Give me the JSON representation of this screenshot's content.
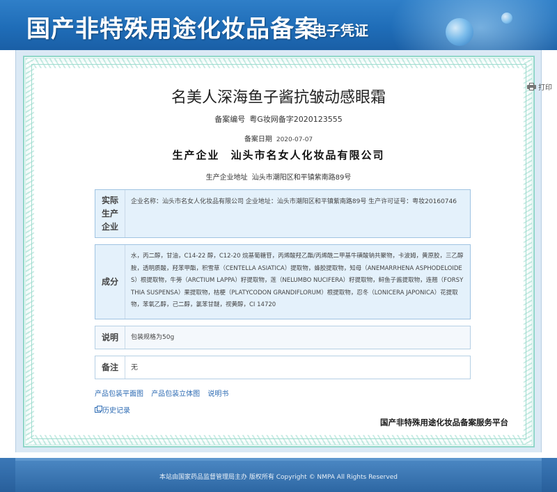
{
  "header": {
    "title": "国产非特殊用途化妆品备案",
    "subtitle": "电子凭证"
  },
  "toolbar": {
    "print_label": "打印"
  },
  "product": {
    "name": "名美人深海鱼子酱抗皱动感眼霜",
    "reg_no_label": "备案编号",
    "reg_no": "粤G妆网备字2020123555",
    "reg_date_label": "备案日期",
    "reg_date": "2020-07-07",
    "company_label": "生产企业",
    "company": "汕头市名女人化妆品有限公司",
    "address_label": "生产企业地址",
    "address": "汕头市潮阳区和平镇紫南路89号"
  },
  "sections": {
    "actual": {
      "label_1": "实际",
      "label_2": "生产",
      "label_3": "企业",
      "content": "企业名称：汕头市名女人化妆品有限公司   企业地址：汕头市潮阳区和平镇紫南路89号   生产许可证号：粤妆20160746"
    },
    "ingredients": {
      "label": "成分",
      "content": "水，丙二醇，甘油，C14-22 醇，C12-20 烷基葡糖苷，丙烯酸羟乙酯/丙烯酰二甲基牛磺酸钠共聚物，卡波姆，黄原胶，三乙醇胺，透明质酸，羟苯甲酯，积雪草（CENTELLA ASIATICA）提取物，蜂胶提取物，知母（ANEMARRHENA ASPHODELOIDES）根提取物，牛蒡（ARCTIUM LAPPA）籽提取物，莲（NELUMBO NUCIFERA）籽提取物，鲟鱼子酱提取物，连翘（FORSYTHIA SUSPENSA）果提取物，桔梗（PLATYCODON GRANDIFLORUM）根提取物，忍冬（LONICERA JAPONICA）花提取物，苯氧乙醇，己二醇，氯苯甘醚，视黄醇，CI 14720"
    },
    "description": {
      "label": "说明",
      "content": "包装规格为50g"
    },
    "remarks": {
      "label": "备注",
      "content": "无"
    }
  },
  "links": {
    "plan": "产品包装平面图",
    "3d": "产品包装立体图",
    "manual": "说明书",
    "history": "历史记录"
  },
  "platform": "国产非特殊用途化妆品备案服务平台",
  "footer": "本站由国家药品监督管理局主办 版权所有 Copyright © NMPA All Rights Reserved"
}
